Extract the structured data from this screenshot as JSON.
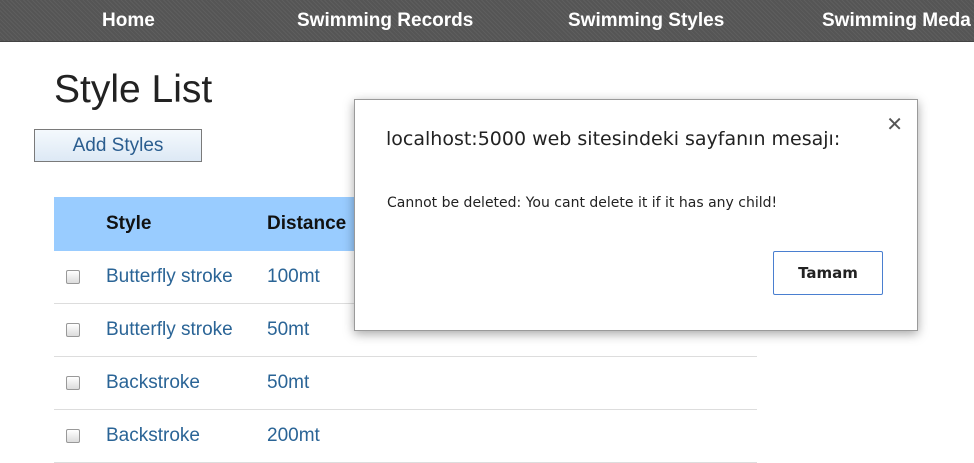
{
  "nav": {
    "items": [
      {
        "label": "Home"
      },
      {
        "label": "Swimming Records"
      },
      {
        "label": "Swimming Styles"
      },
      {
        "label": "Swimming Meda"
      }
    ]
  },
  "page": {
    "title": "Style List",
    "add_button": "Add Styles"
  },
  "table": {
    "headers": {
      "style": "Style",
      "distance": "Distance"
    },
    "rows": [
      {
        "style": "Butterfly stroke",
        "distance": "100mt"
      },
      {
        "style": "Butterfly stroke",
        "distance": "50mt"
      },
      {
        "style": "Backstroke",
        "distance": "50mt"
      },
      {
        "style": "Backstroke",
        "distance": "200mt"
      }
    ]
  },
  "dialog": {
    "title": "localhost:5000 web sitesindeki sayfanın mesajı:",
    "close_icon": "close-icon",
    "message": "Cannot be deleted: You cant delete it if it has any child!",
    "ok_label": "Tamam"
  },
  "colors": {
    "navbar": "#555555",
    "table_header": "#99ccff",
    "link": "#2a6496",
    "dialog_button_border": "#4a7fd0"
  }
}
